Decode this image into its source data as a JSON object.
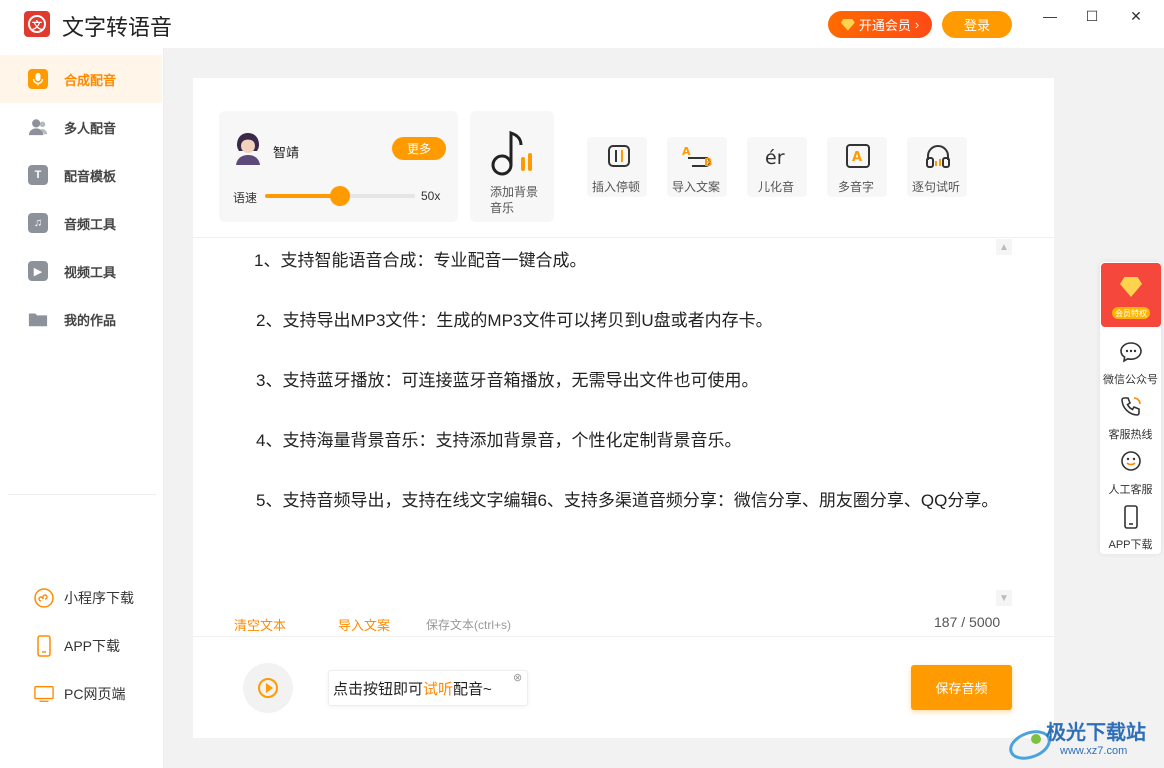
{
  "app": {
    "title": "文字转语音",
    "logo_text": "文",
    "vip_button": "开通会员",
    "login_button": "登录",
    "window_controls": {
      "minimize": "—",
      "maximize": "☐",
      "close": "✕"
    }
  },
  "sidebar": {
    "nav": [
      {
        "label": "合成配音",
        "icon": "microphone-icon",
        "active": true
      },
      {
        "label": "多人配音",
        "icon": "users-icon",
        "active": false
      },
      {
        "label": "配音模板",
        "icon": "template-icon",
        "active": false
      },
      {
        "label": "音频工具",
        "icon": "music-note-icon",
        "active": false
      },
      {
        "label": "视频工具",
        "icon": "video-icon",
        "active": false
      },
      {
        "label": "我的作品",
        "icon": "folder-icon",
        "active": false
      }
    ],
    "links": [
      {
        "label": "小程序下载",
        "icon": "mini-program-icon"
      },
      {
        "label": "APP下载",
        "icon": "phone-icon"
      },
      {
        "label": "PC网页端",
        "icon": "monitor-icon"
      }
    ]
  },
  "voice": {
    "name": "智靖",
    "more_label": "更多",
    "speed_label": "语速",
    "speed_value": "50x",
    "speed_fraction": 0.5
  },
  "bgm": {
    "label": "添加背景音乐"
  },
  "tools": [
    {
      "label": "插入停顿",
      "icon": "pause-insert-icon"
    },
    {
      "label": "导入文案",
      "icon": "import-text-icon"
    },
    {
      "label": "儿化音",
      "icon": "er-sound-icon"
    },
    {
      "label": "多音字",
      "icon": "polyphone-icon"
    },
    {
      "label": "逐句试听",
      "icon": "headphones-icon"
    }
  ],
  "content": {
    "paragraphs": [
      "1、支持智能语音合成：专业配音一键合成。",
      "2、支持导出MP3文件：生成的MP3文件可以拷贝到U盘或者内存卡。",
      "3、支持蓝牙播放：可连接蓝牙音箱播放，无需导出文件也可使用。",
      "4、支持海量背景音乐：支持添加背景音，个性化定制背景音乐。",
      "5、支持音频导出，支持在线文字编辑6、支持多渠道音频分享：微信分享、朋友圈分享、QQ分享。"
    ]
  },
  "editor_actions": {
    "clear": "清空文本",
    "import": "导入文案",
    "save_text": "保存文本(ctrl+s)",
    "count": "187 / 5000"
  },
  "player": {
    "tip_prefix": "点击按钮即可",
    "tip_highlight": "试听",
    "tip_suffix": "配音~",
    "tip_close": "⊗",
    "save_audio": "保存音频"
  },
  "float_bar": {
    "vip_label": "会员特权",
    "items": [
      {
        "label": "微信公众号",
        "icon": "wechat-icon"
      },
      {
        "label": "客服热线",
        "icon": "phone-call-icon"
      },
      {
        "label": "人工客服",
        "icon": "customer-service-icon"
      },
      {
        "label": "APP下载",
        "icon": "mobile-icon"
      }
    ]
  },
  "watermark": {
    "text": "极光下载站",
    "url": "www.xz7.com"
  },
  "colors": {
    "accent": "#ff9a00",
    "brand_red": "#e03a2f",
    "vip_red": "#f5473b"
  }
}
